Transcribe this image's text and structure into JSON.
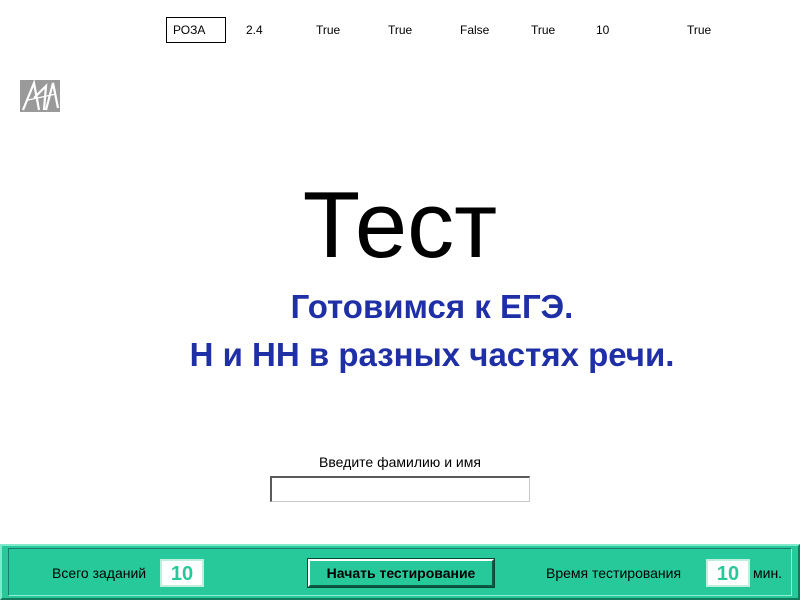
{
  "top_vars": {
    "box_value": "РОЗА",
    "values": [
      "2.4",
      "True",
      "True",
      "False",
      "True",
      "10",
      "True"
    ]
  },
  "logo": {
    "icon": "stylized-letters-logo-icon"
  },
  "title": "Тест",
  "subtitle_line1": "Готовимся к ЕГЭ.",
  "subtitle_line2": "Н и НН в разных частях речи.",
  "name_form": {
    "label": "Введите фамилию и имя",
    "value": ""
  },
  "footer": {
    "total_tasks_label": "Всего заданий",
    "total_tasks_value": "10",
    "start_button_label": "Начать тестирование",
    "time_label": "Время тестирования",
    "time_value": "10",
    "time_unit": "мин."
  },
  "colors": {
    "accent_panel": "#27c99b",
    "subtitle_blue": "#1f2fa6"
  }
}
